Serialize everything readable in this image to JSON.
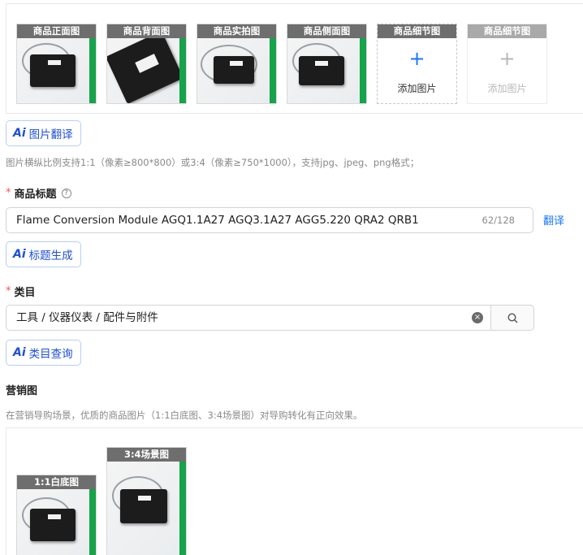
{
  "product_images": {
    "slots": [
      {
        "label": "商品正面图"
      },
      {
        "label": "商品背面图"
      },
      {
        "label": "商品实拍图"
      },
      {
        "label": "商品侧面图"
      },
      {
        "label": "商品细节图",
        "add_text": "添加图片"
      },
      {
        "label": "商品细节图",
        "add_text": "添加图片"
      }
    ],
    "plus_glyph": "+"
  },
  "image_translate": {
    "ai_text": "Ai",
    "label": "图片翻译"
  },
  "image_hint": "图片横纵比例支持1:1（像素≥800*800）或3:4（像素≥750*1000），支持jpg、jpeg、png格式；",
  "title_field": {
    "required_mark": "*",
    "label": "商品标题",
    "help_glyph": "?",
    "value": "Flame Conversion Module AGQ1.1A27 AGQ3.1A27 AGG5.220 QRA2 QRB1",
    "count": "62/128",
    "translate_label": "翻译"
  },
  "title_generate": {
    "ai_text": "Ai",
    "label": "标题生成"
  },
  "category_field": {
    "required_mark": "*",
    "label": "类目",
    "value": "工具 / 仪器仪表 / 配件与附件",
    "clear_glyph": "×"
  },
  "category_query": {
    "ai_text": "Ai",
    "label": "类目查询"
  },
  "marketing": {
    "title": "营销图",
    "hint": "在营销导购场景，优质的商品图片（1:1白底图、3:4场景图）对导购转化有正向效果。",
    "slots": [
      {
        "label": "1:1白底图"
      },
      {
        "label": "3:4场景图"
      }
    ]
  },
  "colors": {
    "accent": "#1677ff",
    "required": "#ff4d4f",
    "label_bg": "#6e6e6e"
  }
}
